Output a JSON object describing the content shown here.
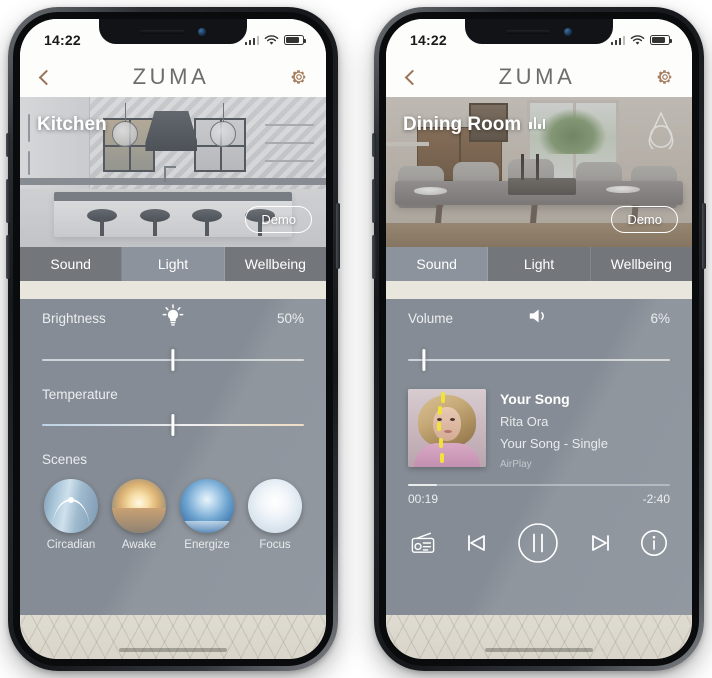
{
  "phones": [
    {
      "id": "left",
      "status": {
        "clock": "14:22",
        "signal_icon": "cellular-bars-icon",
        "wifi_icon": "wifi-icon",
        "battery_icon": "battery-icon"
      },
      "nav": {
        "back_icon": "back-chevron-icon",
        "brand": "ZUMA",
        "settings_icon": "gear-icon"
      },
      "hero": {
        "room": "Kitchen",
        "demo_label": "Demo",
        "scene_type": "kitchen"
      },
      "tabs": [
        {
          "label": "Sound",
          "active": false
        },
        {
          "label": "Light",
          "active": true
        },
        {
          "label": "Wellbeing",
          "active": false
        }
      ],
      "light": {
        "brightness_label": "Brightness",
        "brightness_icon": "lightbulb-icon",
        "brightness_value": "50%",
        "brightness_percent": 50,
        "temperature_label": "Temperature",
        "temperature_percent": 50,
        "scenes_label": "Scenes",
        "scenes": [
          {
            "label": "Circadian",
            "swatch": "circadian"
          },
          {
            "label": "Awake",
            "swatch": "awake"
          },
          {
            "label": "Energize",
            "swatch": "energize"
          },
          {
            "label": "Focus",
            "swatch": "focus"
          }
        ]
      }
    },
    {
      "id": "right",
      "status": {
        "clock": "14:22",
        "signal_icon": "cellular-bars-icon",
        "wifi_icon": "wifi-icon",
        "battery_icon": "battery-icon"
      },
      "nav": {
        "back_icon": "back-chevron-icon",
        "brand": "ZUMA",
        "settings_icon": "gear-icon"
      },
      "hero": {
        "room": "Dining Room",
        "playing_icon": "equalizer-icon",
        "demo_label": "Demo",
        "droplet_icon": "droplet-icon",
        "scene_type": "dining"
      },
      "tabs": [
        {
          "label": "Sound",
          "active": true
        },
        {
          "label": "Light",
          "active": false
        },
        {
          "label": "Wellbeing",
          "active": false
        }
      ],
      "sound": {
        "volume_label": "Volume",
        "volume_icon": "speaker-icon",
        "volume_value": "6%",
        "volume_percent": 6,
        "track_title": "Your Song",
        "track_artist": "Rita Ora",
        "track_album": "Your Song - Single",
        "source": "AirPlay",
        "elapsed": "00:19",
        "remaining": "-2:40",
        "progress_percent": 11,
        "controls": [
          {
            "name": "radio-icon"
          },
          {
            "name": "previous-track-icon"
          },
          {
            "name": "pause-icon"
          },
          {
            "name": "next-track-icon"
          },
          {
            "name": "info-icon"
          }
        ]
      }
    }
  ],
  "colors": {
    "panel": "#858c95",
    "tab_inactive": "#73777c",
    "tab_active": "#8c939c",
    "accent_bronze": "#9a7356",
    "brand_gray": "#6d6d6d",
    "floor": "#e3e0d6"
  }
}
